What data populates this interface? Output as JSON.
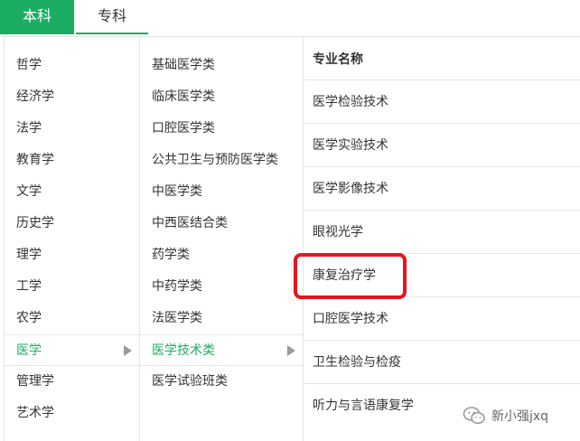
{
  "tabs": {
    "active_label": "本科",
    "inactive_label": "专科",
    "accent_color": "#1bae63"
  },
  "disciplines": [
    {
      "label": "哲学"
    },
    {
      "label": "经济学"
    },
    {
      "label": "法学"
    },
    {
      "label": "教育学"
    },
    {
      "label": "文学"
    },
    {
      "label": "历史学"
    },
    {
      "label": "理学"
    },
    {
      "label": "工学"
    },
    {
      "label": "农学"
    },
    {
      "label": "医学",
      "selected": true
    },
    {
      "label": "管理学"
    },
    {
      "label": "艺术学"
    }
  ],
  "categories": [
    {
      "label": "基础医学类"
    },
    {
      "label": "临床医学类"
    },
    {
      "label": "口腔医学类"
    },
    {
      "label": "公共卫生与预防医学类"
    },
    {
      "label": "中医学类"
    },
    {
      "label": "中西医结合类"
    },
    {
      "label": "药学类"
    },
    {
      "label": "中药学类"
    },
    {
      "label": "法医学类"
    },
    {
      "label": "医学技术类",
      "selected": true
    },
    {
      "label": "医学试验班类"
    }
  ],
  "majors": {
    "header": "专业名称",
    "items": [
      {
        "label": "医学检验技术"
      },
      {
        "label": "医学实验技术"
      },
      {
        "label": "医学影像技术"
      },
      {
        "label": "眼视光学"
      },
      {
        "label": "康复治疗学",
        "highlighted": true
      },
      {
        "label": "口腔医学技术"
      },
      {
        "label": "卫生检验与检疫"
      },
      {
        "label": "听力与言语康复学"
      }
    ]
  },
  "highlight_color": "#e8141d",
  "watermark": {
    "text": "新小强jxq",
    "icon": "wechat-icon"
  }
}
